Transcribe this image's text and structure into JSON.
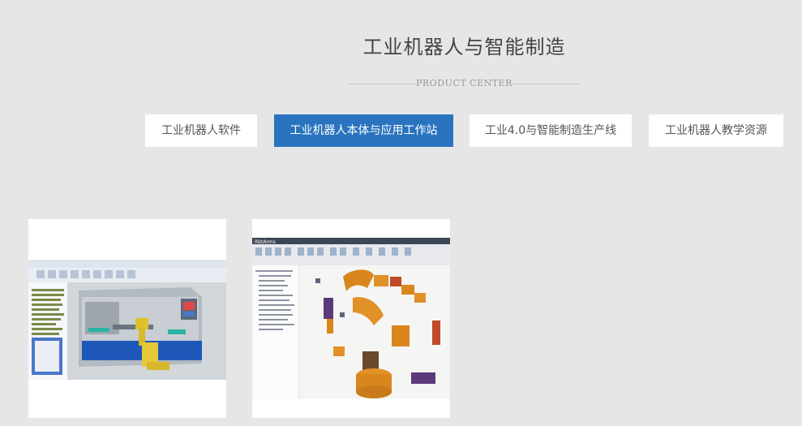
{
  "section": {
    "title": "工业机器人与智能制造",
    "subtitle": "PRODUCT CENTER"
  },
  "tabs": [
    {
      "label": "工业机器人软件",
      "active": false
    },
    {
      "label": "工业机器人本体与应用工作站",
      "active": true
    },
    {
      "label": "工业4.0与智能制造生产线",
      "active": false
    },
    {
      "label": "工业机器人教学资源",
      "active": false
    }
  ],
  "colors": {
    "background": "#e6e6e6",
    "accent": "#2a74bf",
    "tab_background": "#ffffff",
    "title_text": "#444444"
  },
  "products": [
    {
      "image": "cnc-lathe-robot-cad-screenshot"
    },
    {
      "image": "robot-arm-exploded-cad-screenshot",
      "app_name": "RbtArms"
    }
  ]
}
